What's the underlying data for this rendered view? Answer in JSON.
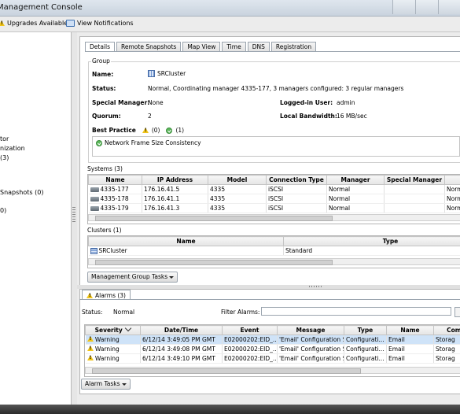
{
  "window": {
    "title": "Management Console"
  },
  "toolbar": {
    "upgrades": "Upgrades Available",
    "notifications": "View Notifications"
  },
  "sidebar": {
    "items": [
      "tor",
      "nization",
      "(3)",
      "Snapshots (0)",
      "0)"
    ]
  },
  "tabs": [
    "Details",
    "Remote Snapshots",
    "Map View",
    "Time",
    "DNS",
    "Registration"
  ],
  "group": {
    "legend": "Group",
    "name_label": "Name:",
    "name_value": "SRCluster",
    "status_label": "Status:",
    "status_value": "Normal, Coordinating manager 4335-177, 3 managers configured: 3 regular managers",
    "special_label": "Special Manager:",
    "special_value": "None",
    "logged_label": "Logged-in User:",
    "logged_value": "admin",
    "quorum_label": "Quorum:",
    "quorum_value": "2",
    "bandwidth_label": "Local Bandwidth:",
    "bandwidth_value": "16 MB/sec",
    "bp_label": "Best Practice",
    "bp_warn_count": "(0)",
    "bp_ok_count": "(1)",
    "bp_item": "Network Frame Size Consistency"
  },
  "systems": {
    "title": "Systems (3)",
    "columns": [
      "Name",
      "IP Address",
      "Model",
      "Connection Type",
      "Manager",
      "Special Manager",
      "R"
    ],
    "rows": [
      [
        "4335-177",
        "176.16.41.5",
        "4335",
        "iSCSI",
        "Normal",
        "",
        "Norm"
      ],
      [
        "4335-178",
        "176.16.41.1",
        "4335",
        "iSCSI",
        "Normal",
        "",
        "Norm"
      ],
      [
        "4335-179",
        "176.16.41.3",
        "4335",
        "iSCSI",
        "Normal",
        "",
        "Norm"
      ]
    ]
  },
  "clusters": {
    "title": "Clusters (1)",
    "columns": [
      "Name",
      "Type"
    ],
    "rows": [
      [
        "SRCluster",
        "Standard"
      ]
    ]
  },
  "buttons": {
    "group_tasks": "Management Group Tasks",
    "alarm_tasks": "Alarm Tasks"
  },
  "alarms": {
    "tab": "Alarms (3)",
    "status_label": "Status:",
    "status_value": "Normal",
    "filter_label": "Filter Alarms:",
    "filter_value": "",
    "columns": [
      "Severity",
      "Date/Time",
      "Event",
      "Message",
      "Type",
      "Name",
      "Comp"
    ],
    "rows": [
      [
        "Warning",
        "6/12/14 3:49:05 PM GMT",
        "E02000202:EID_...",
        "'Email' Configuration S...",
        "Configurati...",
        "Email",
        "Storag"
      ],
      [
        "Warning",
        "6/12/14 3:49:08 PM GMT",
        "E02000202:EID_...",
        "'Email' Configuration S...",
        "Configurati...",
        "Email",
        "Storag"
      ],
      [
        "Warning",
        "6/12/14 3:49:10 PM GMT",
        "E02000202:EID_...",
        "'Email' Configuration S...",
        "Configurati...",
        "Email",
        "Storag"
      ]
    ]
  }
}
